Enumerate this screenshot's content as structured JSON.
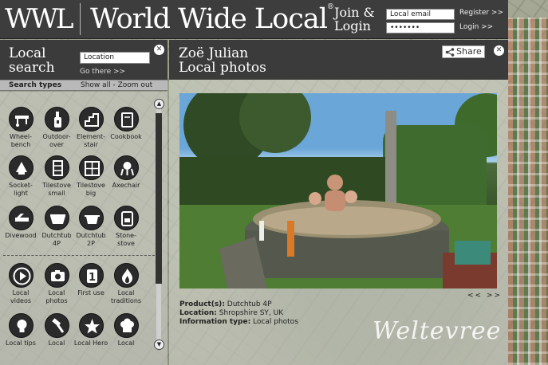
{
  "header": {
    "logo": "WWL",
    "brand": "World Wide Local",
    "brand_mark": "®",
    "join_line1": "Join &",
    "join_line2": "Login",
    "email_value": "Local email",
    "password_value": "•••••••",
    "register_link": "Register >>",
    "login_link": "Login >>"
  },
  "left": {
    "title_line1": "Local",
    "title_line2": "search",
    "location_value": "Location",
    "go_link": "Go there >>",
    "close_glyph": "✕",
    "types_label": "Search types",
    "show_all": "Show all - Zoom out",
    "scroll_up": "▲",
    "scroll_down": "▼",
    "icons_row1": [
      {
        "icon": "wheelbench-icon",
        "l1": "Wheel-",
        "l2": "bench"
      },
      {
        "icon": "outdoor-oven-icon",
        "l1": "Outdoor-",
        "l2": "over"
      },
      {
        "icon": "element-stair-icon",
        "l1": "Element-",
        "l2": "stair"
      },
      {
        "icon": "cookbook-icon",
        "l1": "Cookbook",
        "l2": ""
      }
    ],
    "icons_row2": [
      {
        "icon": "socket-light-icon",
        "l1": "Socket-",
        "l2": "light"
      },
      {
        "icon": "tilestove-small-icon",
        "l1": "Tilestove",
        "l2": "small"
      },
      {
        "icon": "tilestove-big-icon",
        "l1": "Tilestove",
        "l2": "big"
      },
      {
        "icon": "axechair-icon",
        "l1": "Axechair",
        "l2": ""
      }
    ],
    "icons_row3": [
      {
        "icon": "divewood-icon",
        "l1": "Divewood",
        "l2": ""
      },
      {
        "icon": "dutchtub-4p-icon",
        "l1": "Dutchtub",
        "l2": "4P"
      },
      {
        "icon": "dutchtub-2p-icon",
        "l1": "Dutchtub",
        "l2": "2P"
      },
      {
        "icon": "stone-stove-icon",
        "l1": "Stone-",
        "l2": "stove"
      }
    ],
    "icons_row4": [
      {
        "icon": "play-icon",
        "l1": "Local",
        "l2": "videos"
      },
      {
        "icon": "camera-icon",
        "l1": "Local",
        "l2": "photos"
      },
      {
        "icon": "first-use-icon",
        "l1": "First use",
        "l2": "",
        "glyph": "1"
      },
      {
        "icon": "flame-icon",
        "l1": "Local",
        "l2": "traditions"
      }
    ],
    "icons_row5": [
      {
        "icon": "lightbulb-icon",
        "l1": "Local tips",
        "l2": ""
      },
      {
        "icon": "hammer-icon",
        "l1": "Local",
        "l2": ""
      },
      {
        "icon": "star-icon",
        "l1": "Local Hero",
        "l2": ""
      },
      {
        "icon": "chef-hat-icon",
        "l1": "Local",
        "l2": ""
      }
    ]
  },
  "right": {
    "name": "Zoë Julian",
    "subtitle": "Local photos",
    "share_label": "Share",
    "close_glyph": "✕",
    "pager": "<< >>",
    "product_label": "Product(s):",
    "product_value": "Dutchtub 4P",
    "location_label": "Location:",
    "location_value": "Shropshire SY, UK",
    "type_label": "Information type:",
    "type_value": "Local photos",
    "watermark": "Weltevree"
  }
}
